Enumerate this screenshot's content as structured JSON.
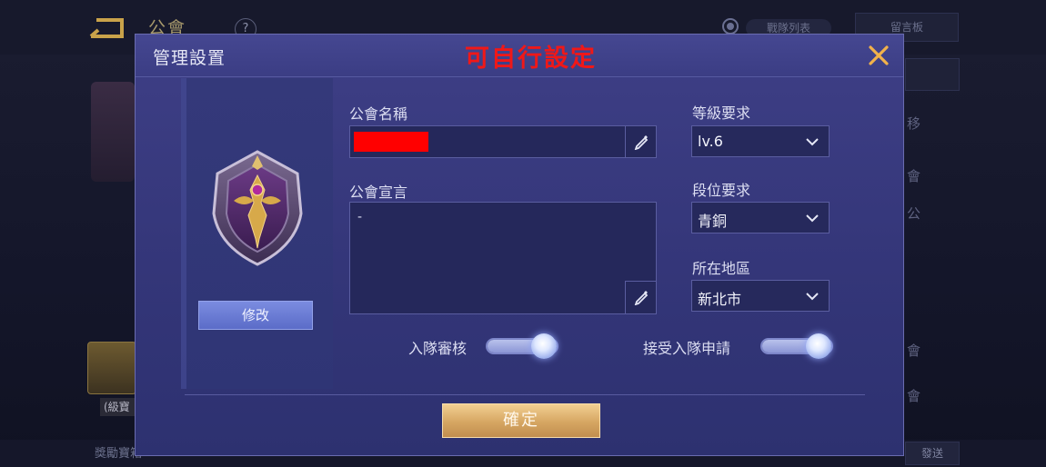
{
  "background": {
    "title": "公會",
    "help": "?",
    "pill_text": "戰隊列表",
    "top_button": "留言板",
    "bottom_left": "獎勵寶箱",
    "chest_label": "(級寶",
    "send": "發送",
    "side_labels": [
      "移",
      "會",
      "公",
      "會",
      "會"
    ]
  },
  "dialog": {
    "title": "管理設置",
    "annotation": "可自行設定",
    "annotation_color": "#f01818",
    "close_icon": "close-icon",
    "modify_button": "修改",
    "guild_name": {
      "label": "公會名稱",
      "value_redacted": true
    },
    "declaration": {
      "label": "公會宣言",
      "value": "-"
    },
    "level_requirement": {
      "label": "等級要求",
      "value": "lv.6"
    },
    "rank_requirement": {
      "label": "段位要求",
      "value": "青銅"
    },
    "region": {
      "label": "所在地區",
      "value": "新北市"
    },
    "toggles": {
      "review": {
        "label": "入隊審核",
        "on": true
      },
      "accept": {
        "label": "接受入隊申請",
        "on": true
      }
    },
    "confirm_button": "確定"
  }
}
